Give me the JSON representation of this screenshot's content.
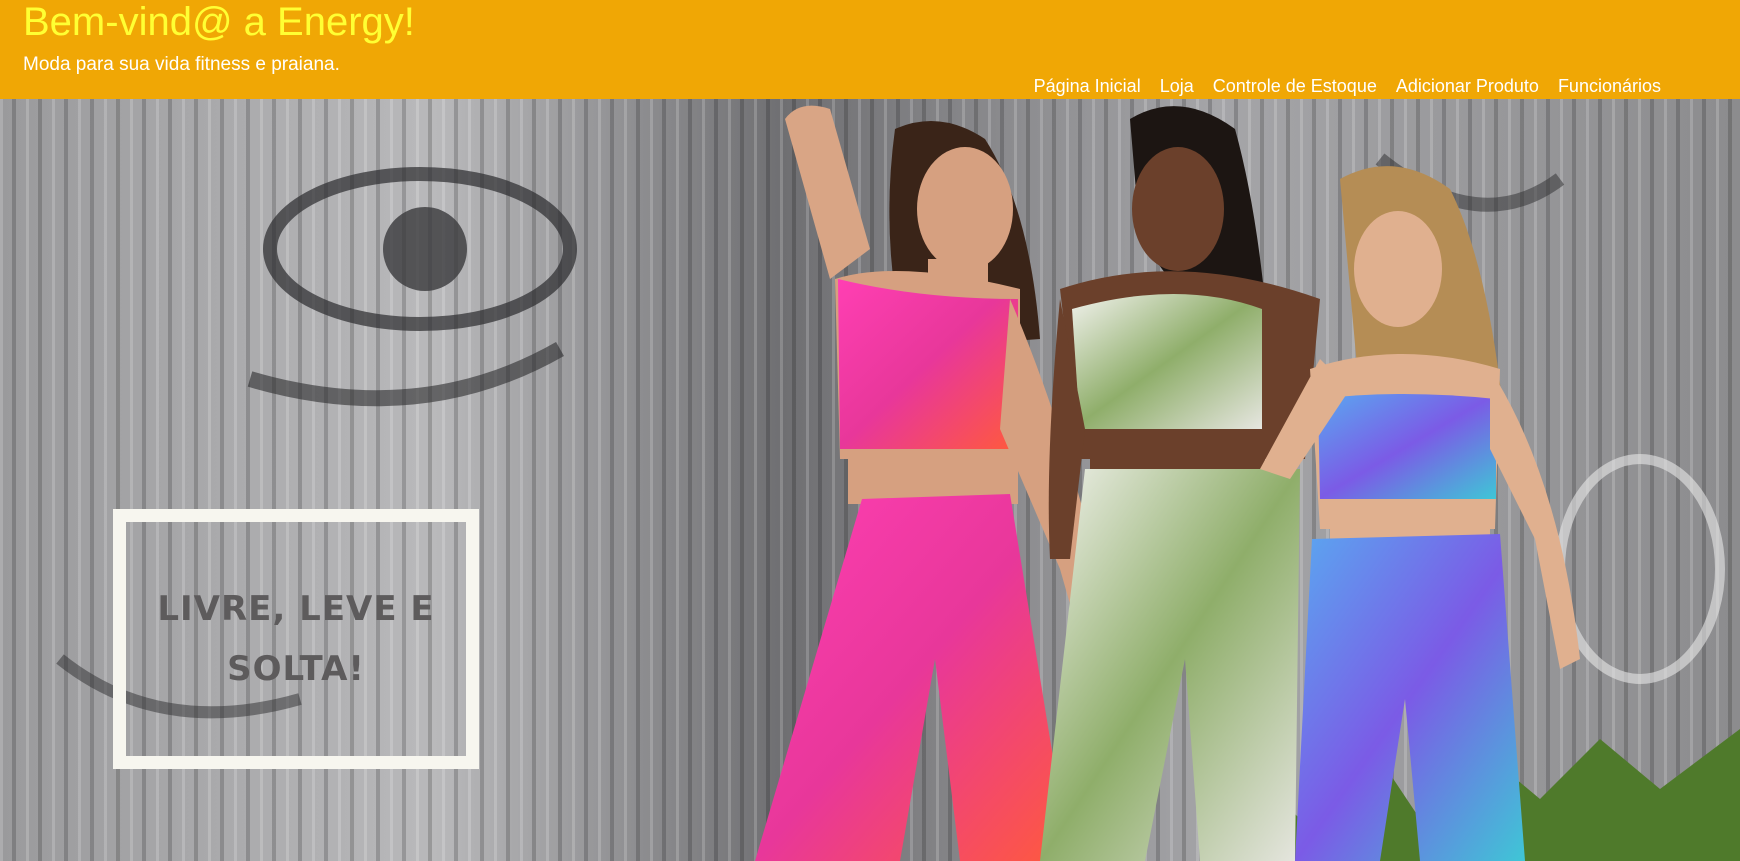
{
  "header": {
    "title": "Bem-vind@ a Energy!",
    "subtitle": "Moda para sua vida fitness e praiana.",
    "background_color": "#f0a705",
    "title_color": "#ffff33"
  },
  "nav": {
    "items": [
      {
        "label": "Página Inicial"
      },
      {
        "label": "Loja"
      },
      {
        "label": "Controle de Estoque"
      },
      {
        "label": "Adicionar Produto"
      },
      {
        "label": "Funcionários"
      }
    ]
  },
  "hero": {
    "tagline": "LIVRE, LEVE E SOLTA!",
    "image": "photo-three-women-fitness-wear-graffiti-wall"
  }
}
